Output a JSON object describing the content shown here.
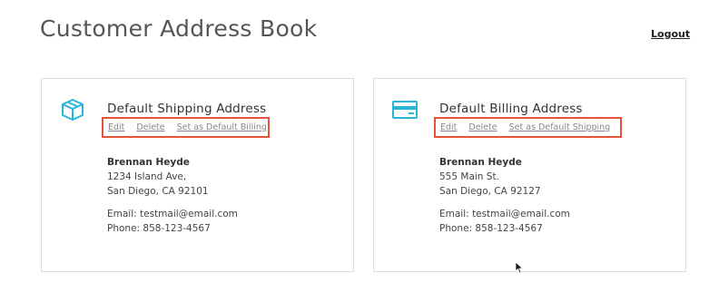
{
  "header": {
    "title": "Customer Address Book",
    "logout_label": "Logout"
  },
  "shipping": {
    "title": "Default Shipping Address",
    "icon": "package-box-icon",
    "actions": [
      "Edit",
      "Delete",
      "Set as Default Billing"
    ],
    "name": "Brennan Heyde",
    "street": "1234 Island Ave,",
    "city_line": "San Diego, CA 92101",
    "email_line": "Email: testmail@email.com",
    "phone_line": "Phone: 858-123-4567"
  },
  "billing": {
    "title": "Default Billing Address",
    "icon": "credit-card-icon",
    "actions": [
      "Edit",
      "Delete",
      "Set as Default Shipping"
    ],
    "name": "Brennan Heyde",
    "street": "555 Main St.",
    "city_line": "San Diego, CA 92127",
    "email_line": "Email: testmail@email.com",
    "phone_line": "Phone: 858-123-4567"
  },
  "colors": {
    "accent_icon": "#29b6d8",
    "highlight_box": "#e4533a"
  }
}
